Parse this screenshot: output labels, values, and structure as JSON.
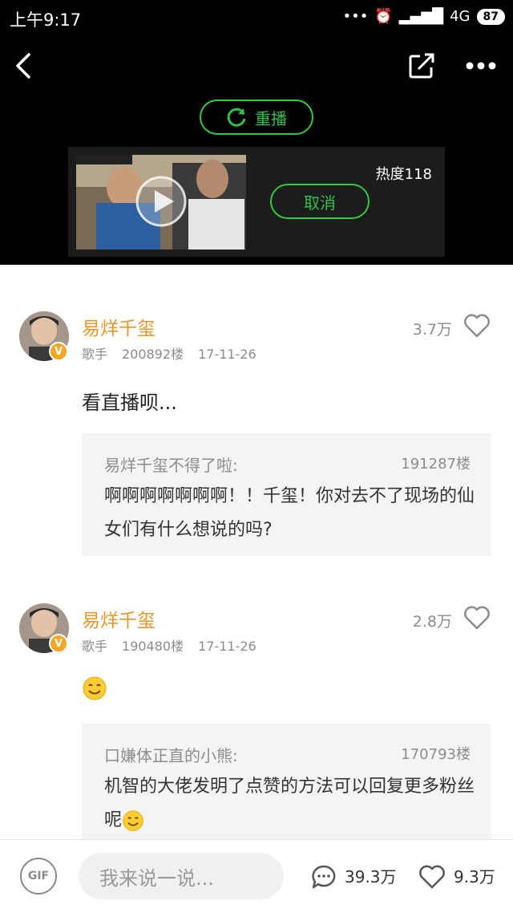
{
  "status_bar": {
    "time": "上午9:17",
    "network": "4G",
    "battery": "87"
  },
  "player": {
    "replay_label": "重播",
    "heat_label": "热度118",
    "cancel_label": "取消"
  },
  "comments": [
    {
      "username": "易烊千玺",
      "role": "歌手",
      "floor": "200892楼",
      "date": "17-11-26",
      "likes": "3.7万",
      "text": "看直播呗...",
      "quote": {
        "username": "易烊千玺不得了啦:",
        "floor": "191287楼",
        "text": "啊啊啊啊啊啊啊！！千玺！你对去不了现场的仙女们有什么想说的吗?"
      }
    },
    {
      "username": "易烊千玺",
      "role": "歌手",
      "floor": "190480楼",
      "date": "17-11-26",
      "likes": "2.8万",
      "text": "",
      "quote": {
        "username": "口嫌体正直的小熊:",
        "floor": "170793楼",
        "text": "机智的大佬发明了点赞的方法可以回复更多粉丝呢"
      }
    }
  ],
  "bottom_bar": {
    "gif_label": "GIF",
    "input_placeholder": "我来说一说...",
    "comment_count": "39.3万",
    "like_count": "9.3万"
  },
  "colors": {
    "accent_green": "#31c14a",
    "username_orange": "#e8962a",
    "vip_badge": "#f5a623"
  }
}
